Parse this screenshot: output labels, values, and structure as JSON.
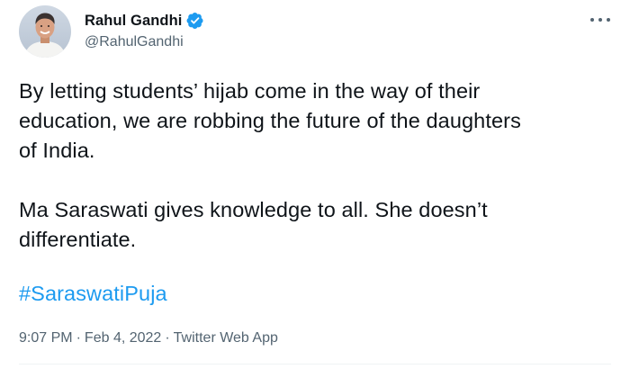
{
  "author": {
    "display_name": "Rahul Gandhi",
    "handle": "@RahulGandhi",
    "verified_icon": "verified-badge-icon",
    "avatar_icon": "profile-avatar"
  },
  "tweet": {
    "body": "By letting students’ hijab come in the way of their\neducation, we are robbing the future of the daughters\nof India.\n\nMa Saraswati gives knowledge to all. She doesn’t\ndifferentiate.",
    "hashtag": "#SaraswatiPuja",
    "time": "9:07 PM",
    "date": "Feb 4, 2022",
    "source": "Twitter Web App",
    "separator": "·"
  },
  "actions": {
    "more_icon": "more-options-icon"
  },
  "colors": {
    "text": "#0f1419",
    "secondary": "#536471",
    "link": "#1d9bf0",
    "verified": "#1d9bf0"
  }
}
